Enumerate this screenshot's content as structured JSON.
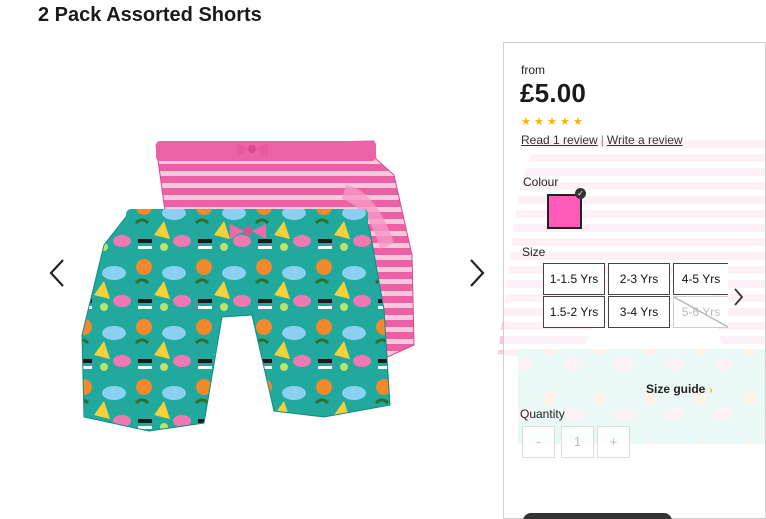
{
  "product": {
    "title": "2 Pack Assorted Shorts",
    "price_prefix": "from",
    "price": "£5.00",
    "rating": {
      "stars": 5,
      "max": 5
    },
    "read_review_label": "Read 1 review",
    "separator": "|",
    "write_review_label": "Write a review"
  },
  "colour": {
    "label": "Colour",
    "selected_hex": "#ff5bb8"
  },
  "size": {
    "label": "Size",
    "options": [
      {
        "label": "1-1.5 Yrs",
        "available": true
      },
      {
        "label": "2-3 Yrs",
        "available": true
      },
      {
        "label": "4-5 Yrs",
        "available": true
      },
      {
        "label": "1.5-2 Yrs",
        "available": true
      },
      {
        "label": "3-4 Yrs",
        "available": true
      },
      {
        "label": "5-6 Yrs",
        "available": false
      }
    ],
    "guide_label": "Size guide"
  },
  "quantity": {
    "label": "Quantity",
    "minus": "-",
    "value": "1",
    "plus": "+"
  },
  "icons": {
    "gallery_prev": "chevron-left-icon",
    "gallery_next": "chevron-right-icon",
    "size_next": "chevron-right-icon",
    "star": "star-icon"
  },
  "colors": {
    "accent_star": "#f5b600",
    "swatch_pink": "#ff5bb8"
  }
}
